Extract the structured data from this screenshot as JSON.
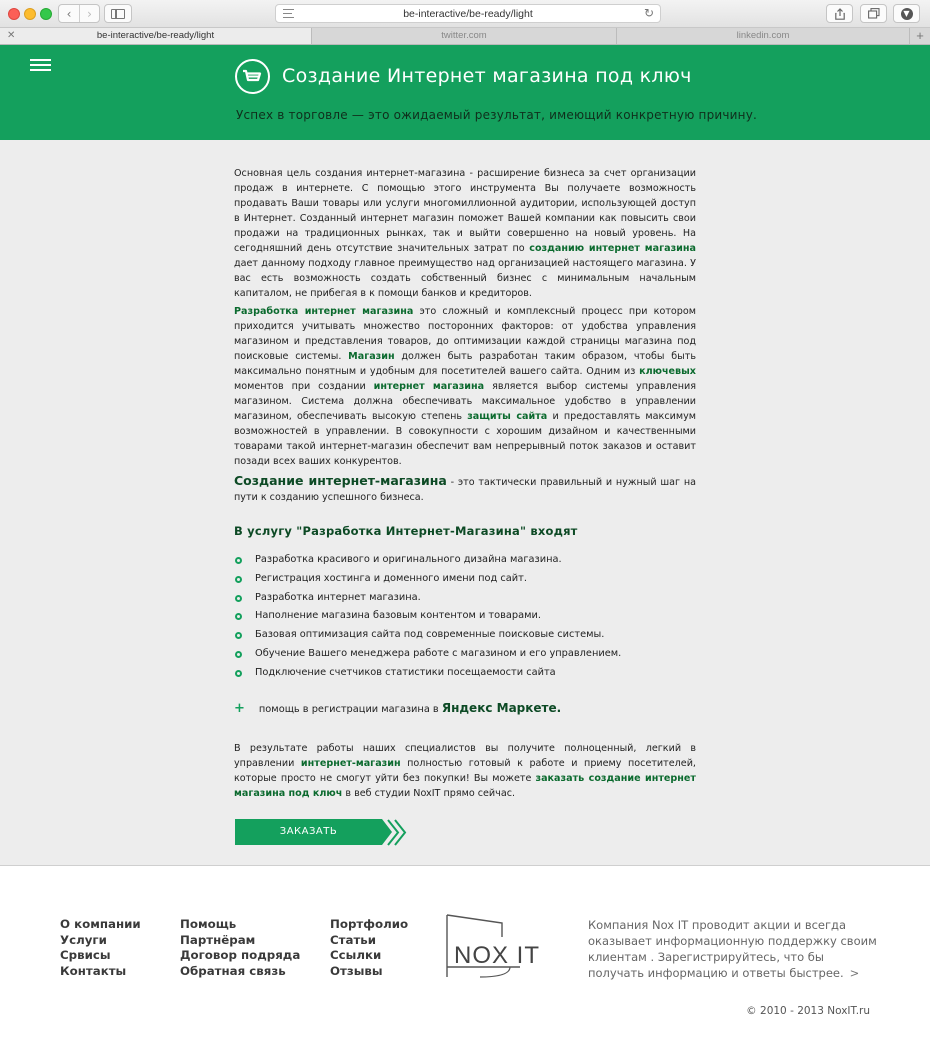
{
  "browser": {
    "url": "be-interactive/be-ready/light",
    "tabs": [
      {
        "label": "be-interactive/be-ready/light",
        "active": true
      },
      {
        "label": "twitter.com",
        "active": false
      },
      {
        "label": "linkedin.com",
        "active": false
      }
    ]
  },
  "hero": {
    "title": "Создание Интернет магазина под ключ",
    "subtitle": "Успех в торговле — это ожидаемый результат, имеющий конкретную причину.",
    "icon": "cart-icon",
    "menu_icon": "hamburger-menu-icon",
    "bg_color": "#14a05d"
  },
  "content": {
    "p1": {
      "t1": "Основная цель создания интернет-магазина - расширение бизнеса за счет организации продаж в интернете. С помощью этого инструмента Вы получаете возможность продавать Ваши товары или услуги многомиллионной аудитории, использующей доступ в Интернет. Созданный интернет магазин поможет Вашей компании как повысить свои продажи на традиционных рынках, так и выйти совершенно на новый уровень. На сегодняшний день отсутствие значительных затрат по ",
      "link1": "созданию интернет магазина",
      "t2": " дает данному подходу главное преимущество над организацией настоящего магазина. У вас есть возможность создать собственный бизнес с минимальным начальным капиталом, не прибегая в к помощи банков и кредиторов."
    },
    "p2": {
      "link1": "Разработка интернет магазина",
      "t1": " это сложный и комплексный процесс при котором приходится учитывать множество посторонних факторов: от удобства управления магазином и представления товаров, до оптимизации каждой страницы магазина под поисковые системы. ",
      "link2": "Магазин",
      "t2": " должен быть разработан таким образом, чтобы быть максимально понятным и удобным для посетителей вашего сайта. Одним из ",
      "link3": "ключевых",
      "t3": " моментов при создании ",
      "link4": "интернет магазина",
      "t4": " является выбор системы управления магазином. Система должна обеспечивать максимальное удобство в управлении магазином, обеспечивать высокую степень ",
      "link5": "защиты сайта",
      "t5": " и предоставлять максимум возможностей в управлении. В совокупности с хорошим дизайном и качественными товарами такой интернет-магазин обеспечит вам непрерывный поток заказов и оставит позади всех ваших конкурентов."
    },
    "p3": {
      "big": "Создание интернет-магазина",
      "t1": " - это тактически правильный и нужный шаг на пути к созданию успешного бизнеса."
    },
    "services_heading": "В услугу \"Разработка Интернет-Магазина\" входят",
    "services": [
      "Разработка красивого и оригинального дизайна магазина.",
      "Регистрация хостинга и доменного имени под сайт.",
      "Разработка интернет магазина.",
      "Наполнение магазина базовым контентом и товарами.",
      "Базовая оптимизация сайта под современные поисковые системы.",
      "Обучение Вашего менеджера работе с магазином и его управлением.",
      "Подключение счетчиков статистики посещаемости сайта"
    ],
    "extra": {
      "sign": "+",
      "text": "помощь в регистрации магазина в ",
      "big": "Яндекс Маркете."
    },
    "p4": {
      "t1": "В результате работы наших специалистов вы получите полноценный, легкий в управлении ",
      "link1": "интернет-магазин",
      "t2": " полностью готовый к работе и приему посетителей, которые просто не смогут уйти без покупки! Вы можете ",
      "link2": "заказать создание интернет магазина под ключ",
      "t3": " в веб студии NoxIT прямо сейчас."
    },
    "order_button": "ЗАКАЗАТЬ"
  },
  "footer": {
    "col1": [
      "О компании",
      "Услуги",
      "Срвисы",
      "Контакты"
    ],
    "col2": [
      "Помощь",
      "Партнёрам",
      "Договор подряда",
      "Обратная связь"
    ],
    "col3": [
      "Портфолио",
      "Статьи",
      "Ссылки",
      "Отзывы"
    ],
    "logo": "NOX IT",
    "promo": "Компания Nox IT проводит акции и всегда оказывает информационную поддержку своим клиентам . Зарегистрируйтесь, что бы получать информацию и ответы быстрее.",
    "promo_arrow": ">",
    "copyright": "© 2010 - 2013 NoxIT.ru"
  }
}
